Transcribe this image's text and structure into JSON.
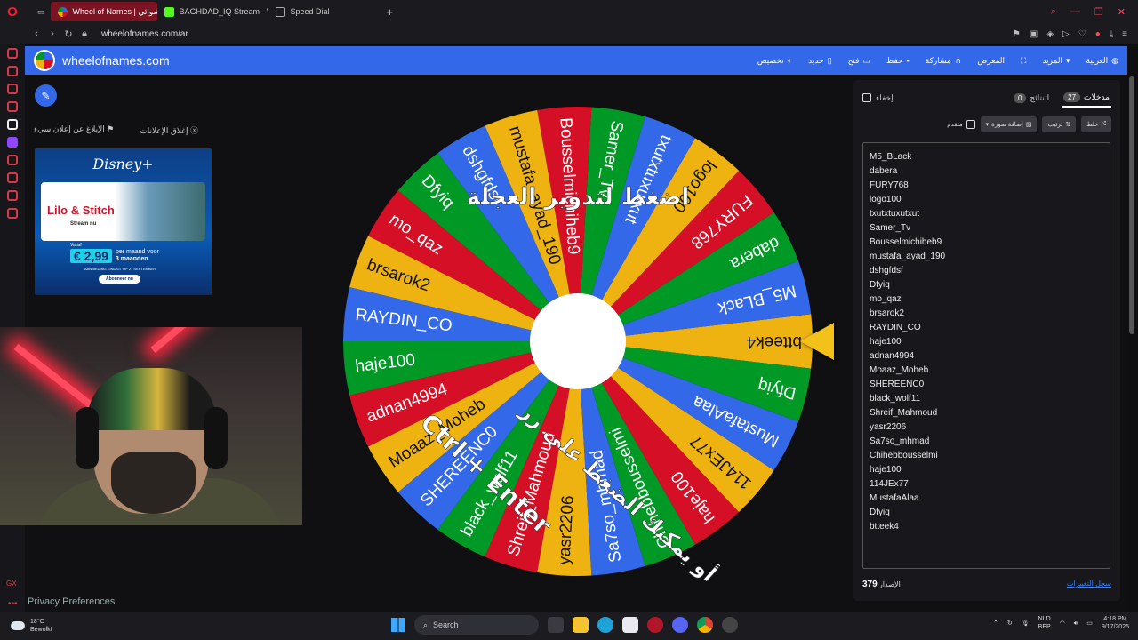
{
  "browser": {
    "tabs": [
      {
        "label": "Wheel of Names | عشوائي",
        "active": true
      },
      {
        "label": "BAGHDAD_IQ Stream - W",
        "active": false
      },
      {
        "label": "Speed Dial",
        "active": false
      }
    ],
    "new_tab": "+",
    "url": "wheelofnames.com/ar"
  },
  "header": {
    "site_name": "wheelofnames.com",
    "menu": {
      "customize": "تخصيص",
      "new": "جديد",
      "open": "فتح",
      "save": "حفظ",
      "share": "مشاركة",
      "gallery": "المعرض",
      "more": "المزيد",
      "language": "العربية"
    }
  },
  "ads": {
    "close_ads": "إغلاق الإعلانات",
    "report_ad": "الإبلاغ عن إعلان سيء",
    "brand": "Disney+",
    "title": "Lilo & Stitch",
    "subtitle": "Stream nu",
    "vanaf": "Vanaf",
    "price": "€ 2,99",
    "per": "per maand voor",
    "duration": "3 maanden",
    "offer": "AANBIEDING EINDIGT OP 27 SEPTEMBER",
    "cta": "Abonneer nu"
  },
  "wheel": {
    "entries": [
      "btteek4",
      "M5_BLack",
      "dabera",
      "FURY768",
      "logo100",
      "txutxtuxutxut",
      "Samer_Tv",
      "Bousselmichiheb9",
      "mustafa_ayad_190",
      "dshgfdsf",
      "Dfyiq",
      "mo_qaz",
      "brsarok2",
      "RAYDIN_CO",
      "haje100",
      "adnan4994",
      "Moaaz_Moheb",
      "SHEREENC0",
      "black_wolf11",
      "Shreif_Mahmoud",
      "yasr2206",
      "Sa7so_mhmad",
      "Chihebbousselmi",
      "haje100",
      "114JEx77",
      "MustafaAlaa",
      "Dfyiq"
    ],
    "colors": [
      "#eeb211",
      "#3369e8",
      "#d50f25",
      "#009925"
    ],
    "spin_text": "اضغط لتدوير العجلة",
    "alt_text": "أو يمكنك الضغط على زر",
    "shortcut": "Ctrl + Enter"
  },
  "panel": {
    "tab_entries": "مدخلات",
    "entries_count": "27",
    "tab_results": "النتائج",
    "results_count": "0",
    "hide": "إخفاء",
    "shuffle": "خلط",
    "sort": "ترتيب",
    "add_image": "إضافة صورة",
    "advanced": "متقدم",
    "entries_list": [
      "M5_BLack",
      "dabera",
      "FURY768",
      "logo100",
      "txutxtuxutxut",
      "Samer_Tv",
      "Bousselmichiheb9",
      "mustafa_ayad_190",
      "dshgfdsf",
      "Dfyiq",
      "mo_qaz",
      "brsarok2",
      "RAYDIN_CO",
      "haje100",
      "adnan4994",
      "Moaaz_Moheb",
      "SHEREENC0",
      "black_wolf11",
      "Shreif_Mahmoud",
      "yasr2206",
      "Sa7so_mhmad",
      "Chihebbousselmi",
      "haje100",
      "114JEx77",
      "MustafaAlaa",
      "Dfyiq",
      "btteek4"
    ],
    "version_label": "الإصدار",
    "version": "379",
    "changelog": "سجل التغييرات"
  },
  "other": {
    "privacy": "Privacy Preferences"
  },
  "taskbar": {
    "temp": "18°C",
    "weather": "Bewolkt",
    "search": "Search",
    "lang1": "NLD",
    "lang2": "BEP",
    "time": "4:18 PM",
    "date": "9/17/2025"
  }
}
